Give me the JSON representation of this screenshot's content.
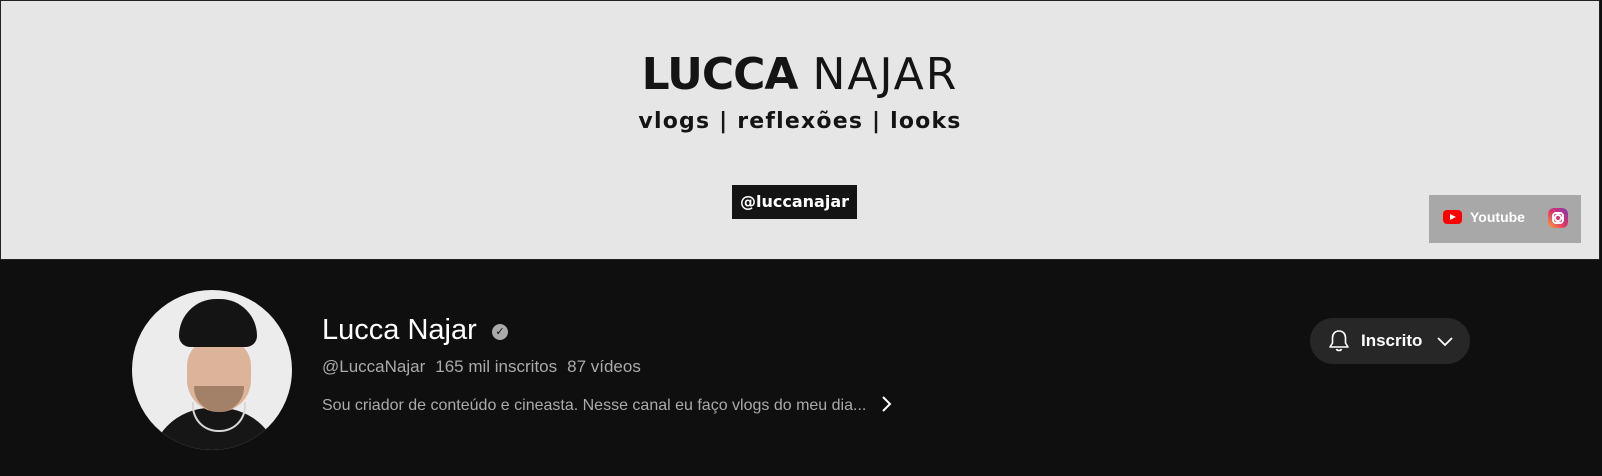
{
  "banner": {
    "title_first": "LUCCA",
    "title_last": "NAJAR",
    "subtitle": "vlogs | reflexões | looks",
    "handle": "@luccanajar",
    "links": [
      {
        "label": "Youtube",
        "icon": "youtube-icon"
      },
      {
        "label": "",
        "icon": "instagram-icon"
      }
    ]
  },
  "channel": {
    "name": "Lucca Najar",
    "verified_icon": "verified-check-icon",
    "handle": "@LuccaNajar",
    "subscribers": "165 mil inscritos",
    "videos": "87 vídeos",
    "description": "Sou criador de conteúdo e cineasta. Nesse canal eu faço vlogs do meu dia...",
    "more_icon": "chevron-right-icon"
  },
  "subscribe_button": {
    "label": "Inscrito",
    "bell_icon": "bell-icon",
    "chevron_icon": "chevron-down-icon"
  },
  "colors": {
    "page_bg": "#0f0f0f",
    "banner_bg": "#e6e6e6",
    "button_bg": "#272727",
    "secondary_text": "#aaaaaa"
  }
}
